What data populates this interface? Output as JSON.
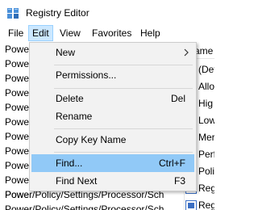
{
  "window": {
    "title": "Registry Editor",
    "icon": "registry-editor-icon"
  },
  "menubar": {
    "items": [
      {
        "label": "File",
        "active": false
      },
      {
        "label": "Edit",
        "active": true
      },
      {
        "label": "View",
        "active": false
      },
      {
        "label": "Favorites",
        "active": false
      },
      {
        "label": "Help",
        "active": false
      }
    ]
  },
  "tree": {
    "rows": [
      "Powe",
      "Powe",
      "Powe",
      "Powe",
      "Powe",
      "Powe",
      "Powe",
      "Powe",
      "Powe",
      "Powe",
      "Powe",
      "Power/Policy/Settings/Processor/Sch",
      "Power/Policy/Settings/Processor/Sch"
    ]
  },
  "values_pane": {
    "header": "ame",
    "rows": [
      "(Def",
      "Allo",
      "Hig",
      "Low",
      "Mer",
      "Perf",
      "Poli",
      "Reg",
      "Reg"
    ],
    "icon": "registry-value-icon"
  },
  "edit_menu": {
    "items": [
      {
        "label": "New",
        "shortcut": "",
        "submenu": true,
        "highlighted": false
      },
      {
        "label": "Permissions...",
        "shortcut": "",
        "submenu": false,
        "highlighted": false
      },
      {
        "label": "Delete",
        "shortcut": "Del",
        "submenu": false,
        "highlighted": false
      },
      {
        "label": "Rename",
        "shortcut": "",
        "submenu": false,
        "highlighted": false
      },
      {
        "label": "Copy Key Name",
        "shortcut": "",
        "submenu": false,
        "highlighted": false
      },
      {
        "label": "Find...",
        "shortcut": "Ctrl+F",
        "submenu": false,
        "highlighted": true
      },
      {
        "label": "Find Next",
        "shortcut": "F3",
        "submenu": false,
        "highlighted": false
      }
    ]
  },
  "colors": {
    "menu_background": "#f2f2f2",
    "menu_highlight": "#91c9f7",
    "menubar_active": "#cce8ff",
    "value_icon_blue": "#3b6fc4",
    "value_icon_red": "#c8342b"
  }
}
